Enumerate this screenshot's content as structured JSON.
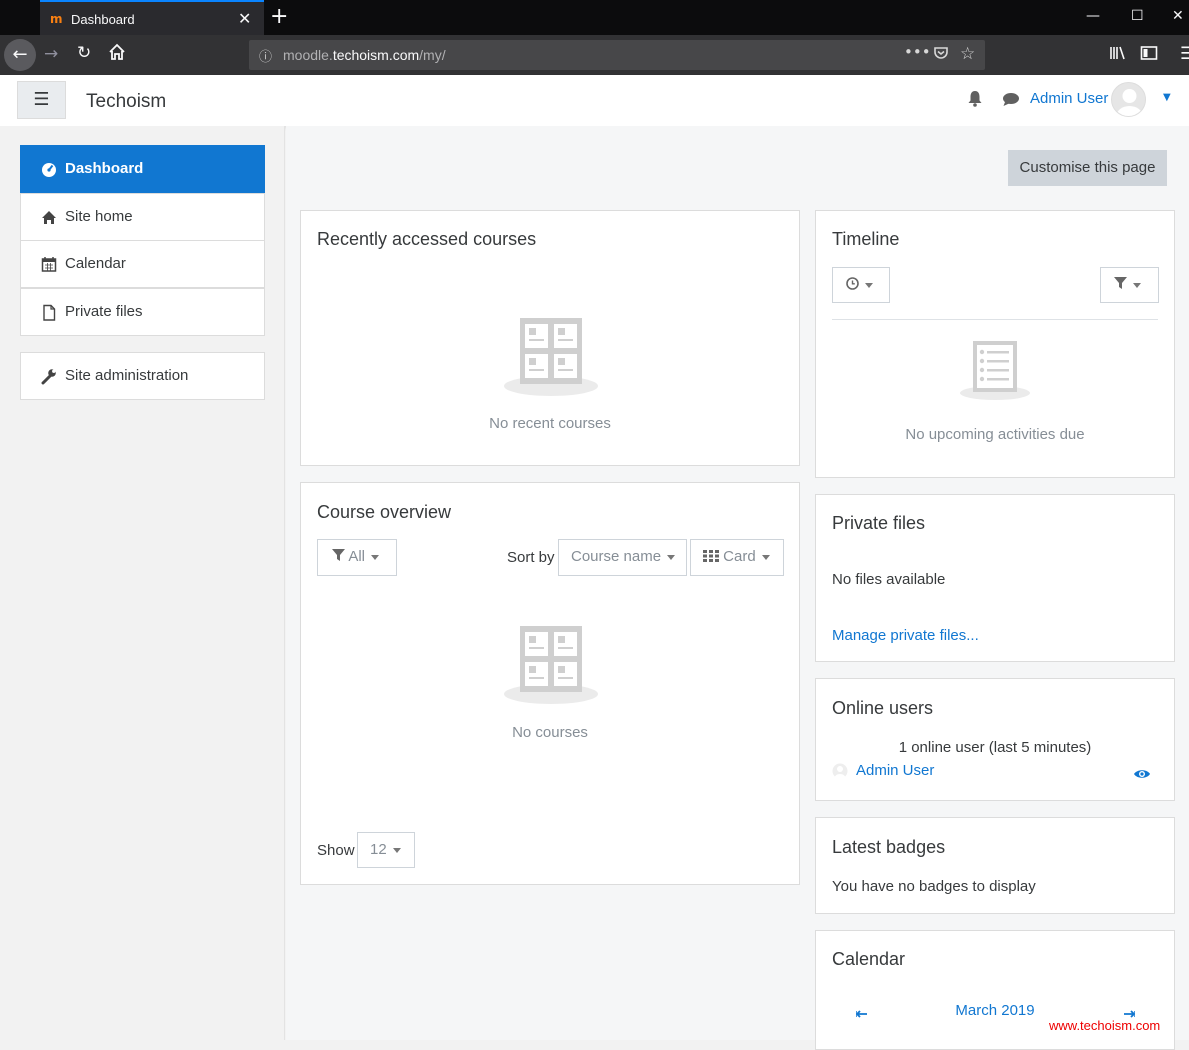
{
  "browser": {
    "tab_logo": "m",
    "tab_title": "Dashboard",
    "tab_close": "✕",
    "new_tab": "+",
    "url_host_pre": "moodle.",
    "url_host_main": "techoism.com",
    "url_path": "/my/",
    "window_controls": [
      "—",
      "☐",
      "✕"
    ]
  },
  "header": {
    "site_name": "Techoism",
    "user_name": "Admin User"
  },
  "nav": {
    "items": [
      {
        "label": "Dashboard",
        "icon": "dashboard-icon"
      },
      {
        "label": "Site home",
        "icon": "home-icon"
      },
      {
        "label": "Calendar",
        "icon": "calendar-icon"
      },
      {
        "label": "Private files",
        "icon": "file-icon"
      }
    ],
    "admin": {
      "label": "Site administration",
      "icon": "wrench-icon"
    }
  },
  "main": {
    "customise_label": "Customise this page",
    "recent": {
      "title": "Recently accessed courses",
      "empty": "No recent courses"
    },
    "overview": {
      "title": "Course overview",
      "filter_label": "All",
      "sort_by_label": "Sort by",
      "sort_value": "Course name",
      "view_value": "Card",
      "empty": "No courses",
      "show_label": "Show",
      "show_value": "12"
    },
    "timeline": {
      "title": "Timeline",
      "empty": "No upcoming activities due"
    },
    "private_files": {
      "title": "Private files",
      "empty": "No files available",
      "manage_link": "Manage private files..."
    },
    "online_users": {
      "title": "Online users",
      "summary": "1 online user (last 5 minutes)",
      "user": "Admin User"
    },
    "badges": {
      "title": "Latest badges",
      "empty": "You have no badges to display"
    },
    "calendar": {
      "title": "Calendar",
      "month": "March 2019"
    }
  },
  "watermark": "www.techoism.com",
  "colors": {
    "accent": "#1177d1",
    "watermark": "#ee0000"
  }
}
